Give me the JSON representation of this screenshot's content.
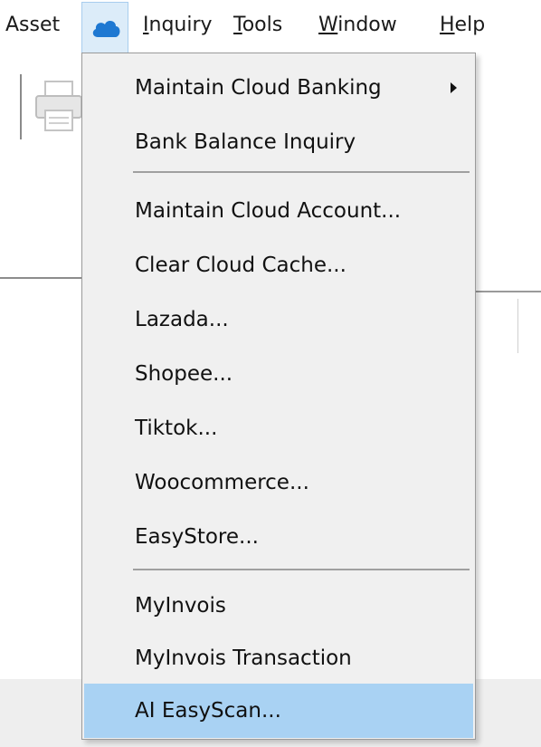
{
  "menubar": {
    "items": [
      {
        "label": "Asset"
      },
      {
        "label": "Inquiry",
        "mnemonic": "I",
        "rest": "nquiry"
      },
      {
        "label": "Tools",
        "mnemonic": "T",
        "rest": "ools"
      },
      {
        "label": "Window",
        "mnemonic": "W",
        "rest": "indow"
      },
      {
        "label": "Help",
        "mnemonic": "H",
        "rest": "elp"
      }
    ],
    "cloud_icon": "cloud-icon",
    "accent": "#1e78d2"
  },
  "dropdown": {
    "items": [
      {
        "label": "Maintain Cloud Banking",
        "has_submenu": true
      },
      {
        "label": "Bank Balance Inquiry"
      },
      {
        "label": "Maintain Cloud Account..."
      },
      {
        "label": "Clear Cloud Cache..."
      },
      {
        "label": "Lazada..."
      },
      {
        "label": "Shopee..."
      },
      {
        "label": "Tiktok..."
      },
      {
        "label": "Woocommerce..."
      },
      {
        "label": "EasyStore..."
      },
      {
        "label": "MyInvois"
      },
      {
        "label": "MyInvois Transaction"
      },
      {
        "label": "AI EasyScan...",
        "highlighted": true
      }
    ],
    "highlight_color": "#a9d2f3"
  }
}
